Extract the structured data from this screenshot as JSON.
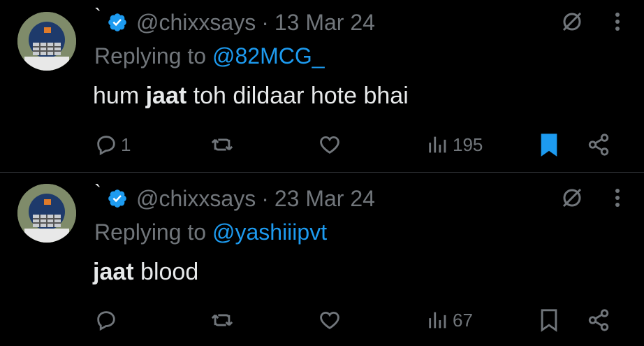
{
  "tweets": [
    {
      "tick": "`",
      "handle": "@chixxsays",
      "dot": "·",
      "date": "13 Mar 24",
      "replying_prefix": "Replying to ",
      "replying_to": "@82MCG_",
      "text_bold": "jaat",
      "text_before": "hum ",
      "text_after": " toh dildaar hote bhai",
      "reply_count": "1",
      "retweet_count": "",
      "like_count": "",
      "view_count": "195",
      "bookmarked": true
    },
    {
      "tick": "`",
      "handle": "@chixxsays",
      "dot": "·",
      "date": "23 Mar 24",
      "replying_prefix": "Replying to ",
      "replying_to": "@yashiiipvt",
      "text_bold": "jaat",
      "text_before": "",
      "text_after": " blood",
      "reply_count": "",
      "retweet_count": "",
      "like_count": "",
      "view_count": "67",
      "bookmarked": false
    }
  ],
  "colors": {
    "background": "#000000",
    "text": "#e7e9ea",
    "muted": "#71767b",
    "accent": "#1d9bf0",
    "divider": "#2f3336"
  },
  "icons": [
    "verified-badge-icon",
    "grok-icon",
    "more-icon",
    "reply-icon",
    "retweet-icon",
    "like-icon",
    "views-icon",
    "bookmark-icon",
    "share-icon"
  ]
}
